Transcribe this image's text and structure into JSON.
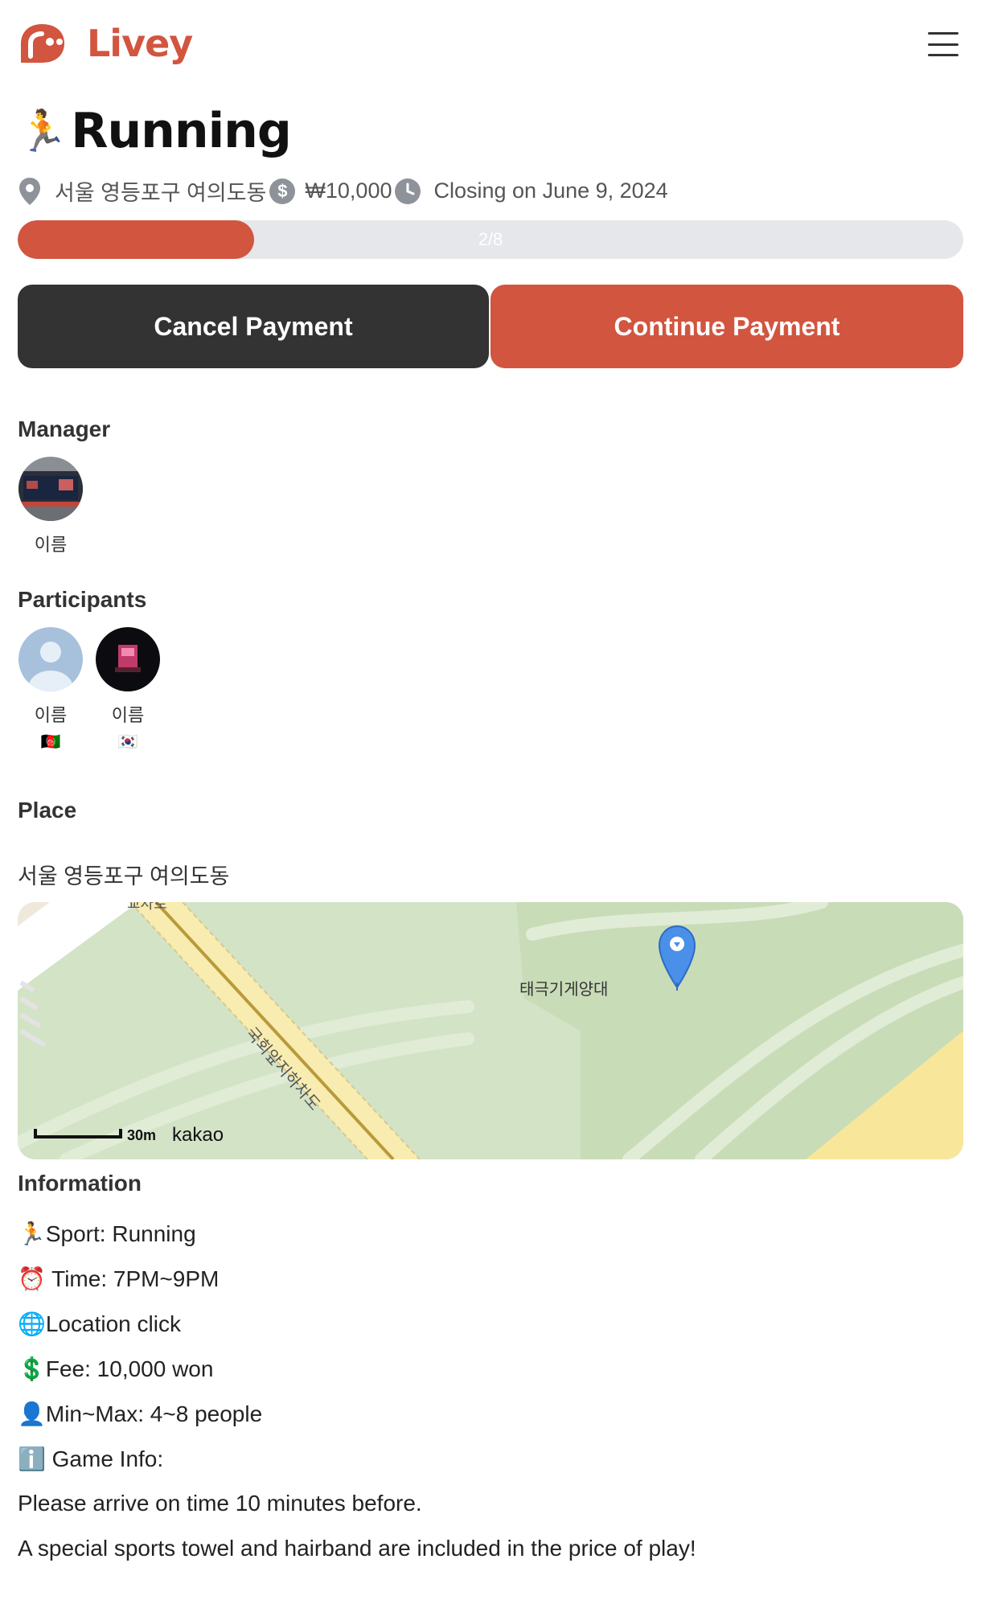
{
  "header": {
    "logo_text": "Livey",
    "menu_icon": "hamburger-menu-icon"
  },
  "event": {
    "title_emoji": "🏃",
    "title": "Running",
    "address": "서울 영등포구 여의도동",
    "fee": "₩10,000",
    "closing": "Closing on June 9, 2024",
    "progress_label": "2/8",
    "progress_value": 0.25
  },
  "actions": {
    "cancel_label": "Cancel Payment",
    "continue_label": "Continue Payment"
  },
  "manager": {
    "section_title": "Manager",
    "name": "이름"
  },
  "participants": {
    "section_title": "Participants",
    "items": [
      {
        "name": "이름",
        "flag": "🇦🇫"
      },
      {
        "name": "이름",
        "flag": "🇰🇷"
      }
    ]
  },
  "place": {
    "section_title": "Place",
    "address": "서울 영등포구 여의도동",
    "map_labels": {
      "poi": "태극기게양대",
      "road": "국회앞지하차도",
      "road_top": "교차로",
      "scale": "30m",
      "provider": "kakao"
    }
  },
  "information": {
    "section_title": "Information",
    "lines": [
      "🏃Sport: Running",
      "⏰ Time: 7PM~9PM",
      "🌐Location click",
      "💲Fee: 10,000 won",
      "👤Min~Max: 4~8 people",
      "ℹ️ Game Info:",
      "Please arrive on time 10 minutes before.",
      "A special sports towel and hairband are included in the price of play!"
    ]
  },
  "colors": {
    "accent": "#d2553f",
    "dark_button": "#333334",
    "progress_track": "#e6e7ea"
  }
}
